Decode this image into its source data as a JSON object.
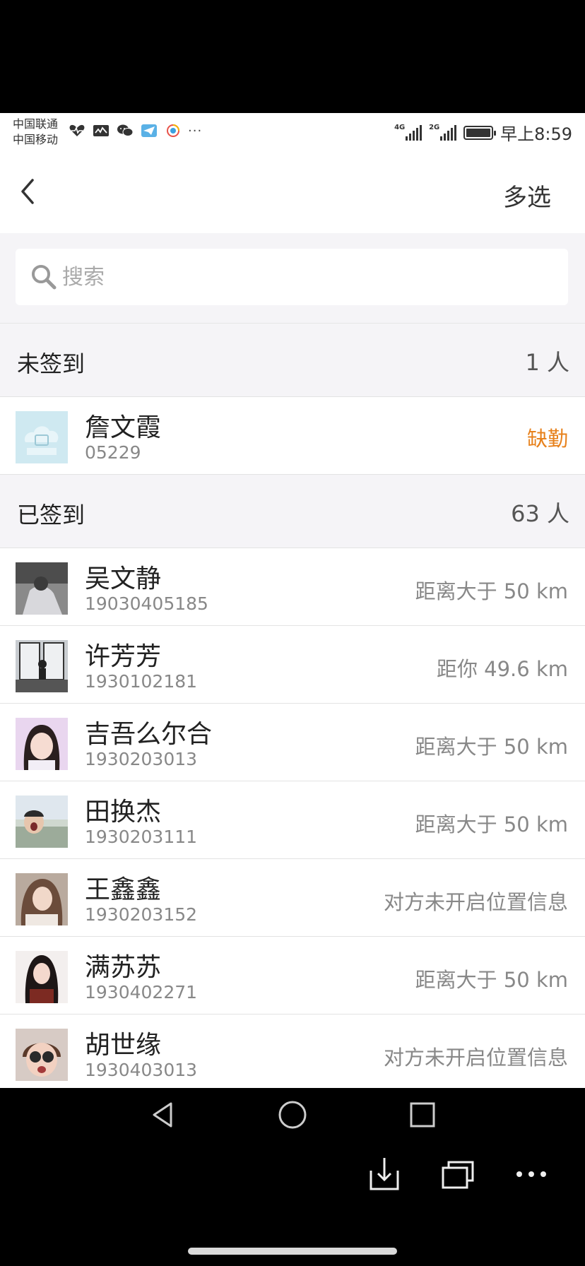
{
  "status_bar": {
    "carrier_1": "中国联通",
    "carrier_2": "中国移动",
    "network_1": "4G",
    "network_2": "2G",
    "clock": "早上8:59",
    "notification_icons": [
      "heart-rate-icon",
      "activity-icon",
      "wechat-icon",
      "paper-plane-icon",
      "browser-icon",
      "more-dots-icon"
    ]
  },
  "navbar": {
    "back_icon": "chevron-left-icon",
    "multi_select_label": "多选"
  },
  "search": {
    "placeholder": "搜索",
    "value": ""
  },
  "sections": {
    "not_signed": {
      "title": "未签到",
      "count": "1 人",
      "items": [
        {
          "name": "詹文霞",
          "id": "05229",
          "status": "缺勤",
          "status_color": "#e7811c"
        }
      ]
    },
    "signed": {
      "title": "已签到",
      "count": "63 人",
      "items": [
        {
          "name": "吴文静",
          "id": "19030405185",
          "status": "距离大于 50 km"
        },
        {
          "name": "许芳芳",
          "id": "1930102181",
          "status": "距你 49.6 km"
        },
        {
          "name": "吉吾么尔合",
          "id": "1930203013",
          "status": "距离大于 50 km"
        },
        {
          "name": "田换杰",
          "id": "1930203111",
          "status": "距离大于 50 km"
        },
        {
          "name": "王鑫鑫",
          "id": "1930203152",
          "status": "对方未开启位置信息"
        },
        {
          "name": "满苏苏",
          "id": "1930402271",
          "status": "距离大于 50 km"
        },
        {
          "name": "胡世缘",
          "id": "1930403013",
          "status": "对方未开启位置信息"
        }
      ]
    }
  },
  "system_nav": {
    "buttons": [
      "back-triangle-icon",
      "home-circle-icon",
      "recents-square-icon",
      "download-icon",
      "windows-icon",
      "more-dots-icon"
    ]
  },
  "colors": {
    "accent_absent": "#e7811c",
    "section_bg": "#f5f4f7",
    "text_primary": "#222222",
    "text_secondary": "#888888"
  }
}
